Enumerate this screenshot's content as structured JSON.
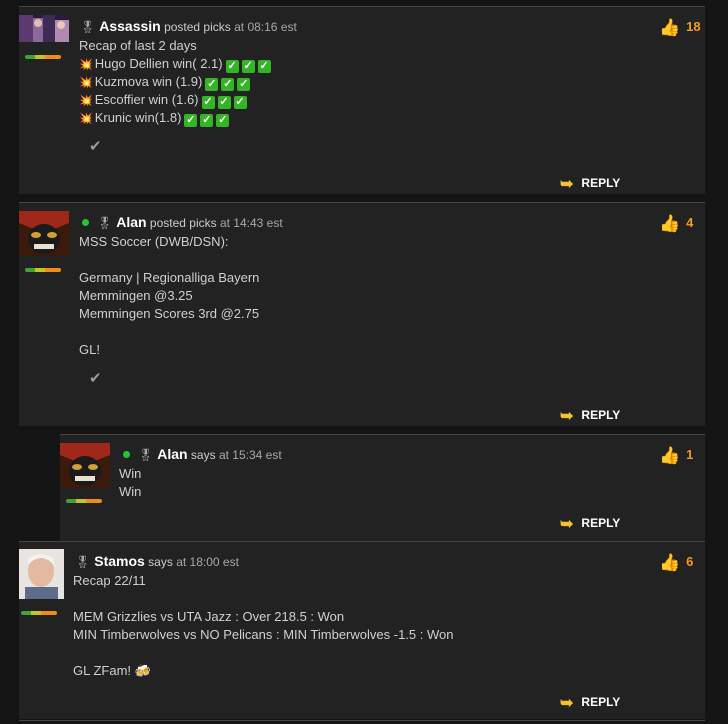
{
  "posts": [
    {
      "user": "Assassin",
      "verb": "posted picks",
      "time": "at 08:16 est",
      "likes": "18",
      "online": false,
      "lines": [
        {
          "text": "Recap of last 2 days",
          "boom": false,
          "checks": 0
        },
        {
          "text": "Hugo Dellien win( 2.1)",
          "boom": true,
          "checks": 3
        },
        {
          "text": "Kuzmova win (1.9)",
          "boom": true,
          "checks": 3
        },
        {
          "text": "Escoffier win (1.6)",
          "boom": true,
          "checks": 3
        },
        {
          "text": "Krunic win(1.8)",
          "boom": true,
          "checks": 3
        }
      ],
      "reply": "REPLY"
    },
    {
      "user": "Alan",
      "verb": "posted picks",
      "time": "at 14:43 est",
      "likes": "4",
      "online": true,
      "lines": [
        {
          "text": "MSS Soccer (DWB/DSN):"
        },
        {
          "text": ""
        },
        {
          "text": "Germany | Regionalliga Bayern"
        },
        {
          "text": "Memmingen @3.25"
        },
        {
          "text": "Memmingen Scores 3rd @2.75"
        },
        {
          "text": ""
        },
        {
          "text": "GL!"
        }
      ],
      "reply": "REPLY"
    },
    {
      "user": "Alan",
      "verb": "says",
      "time": "at 15:34 est",
      "likes": "1",
      "online": true,
      "lines": [
        {
          "text": "Win"
        },
        {
          "text": "Win"
        }
      ],
      "reply": "REPLY"
    },
    {
      "user": "Stamos",
      "verb": "says",
      "time": "at 18:00 est",
      "likes": "6",
      "online": false,
      "lines": [
        {
          "text": "Recap 22/11"
        },
        {
          "text": ""
        },
        {
          "text": "MEM Grizzlies vs UTA Jazz : Over 218.5 : Won"
        },
        {
          "text": "MIN Timberwolves vs NO Pelicans : MIN Timberwolves -1.5 : Won"
        },
        {
          "text": ""
        },
        {
          "text": "GL ZFam! 🍻"
        }
      ],
      "reply": "REPLY"
    }
  ],
  "icons": {
    "thumb": "thumbs-up-icon",
    "reply": "reply-arrow-icon",
    "check": "checkmark-icon",
    "boom": "explosion-icon",
    "medal": "medal-icon"
  },
  "colors": {
    "accent": "#f29a22",
    "reply_arrow": "#f3c233",
    "online": "#28c23a",
    "check_green": "#33b526"
  }
}
